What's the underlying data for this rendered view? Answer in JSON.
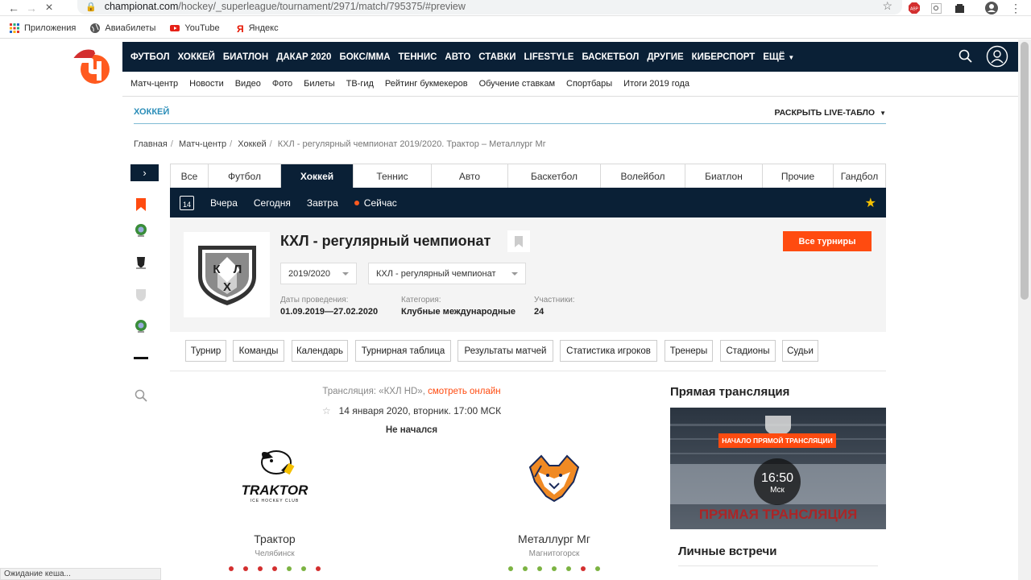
{
  "browser": {
    "url_host": "championat.com",
    "url_path": "/hockey/_superleague/tournament/2971/match/795375/#preview",
    "status_text": "Ожидание кеша..."
  },
  "bookmarks": [
    {
      "label": "Приложения",
      "icon": "apps-grid-icon"
    },
    {
      "label": "Авиабилеты",
      "icon": "globe-icon"
    },
    {
      "label": "YouTube",
      "icon": "youtube-icon"
    },
    {
      "label": "Яндекс",
      "icon": "yandex-icon"
    }
  ],
  "header": {
    "nav": [
      "ФУТБОЛ",
      "ХОККЕЙ",
      "БИАТЛОН",
      "ДАКАР 2020",
      "БОКС/ММА",
      "ТЕННИС",
      "АВТО",
      "СТАВКИ",
      "LIFESTYLE",
      "БАСКЕТБОЛ",
      "ДРУГИЕ",
      "КИБЕРСПОРТ",
      "ЕЩЁ"
    ],
    "subnav": [
      "Матч-центр",
      "Новости",
      "Видео",
      "Фото",
      "Билеты",
      "ТВ-гид",
      "Рейтинг букмекеров",
      "Обучение ставкам",
      "Спортбары",
      "Итоги 2019 года"
    ]
  },
  "section": {
    "title": "ХОККЕЙ",
    "live_link": "РАСКРЫТЬ LIVE-ТАБЛО"
  },
  "breadcrumbs": [
    "Главная",
    "Матч-центр",
    "Хоккей",
    "КХЛ - регулярный чемпионат 2019/2020. Трактор – Металлург Мг"
  ],
  "sport_tabs": [
    {
      "label": "Все",
      "active": false
    },
    {
      "label": "Футбол",
      "active": false
    },
    {
      "label": "Хоккей",
      "active": true
    },
    {
      "label": "Теннис",
      "active": false
    },
    {
      "label": "Авто",
      "active": false
    },
    {
      "label": "Баскетбол",
      "active": false
    },
    {
      "label": "Волейбол",
      "active": false
    },
    {
      "label": "Биатлон",
      "active": false
    },
    {
      "label": "Прочие",
      "active": false
    },
    {
      "label": "Гандбол",
      "active": false
    }
  ],
  "daybar": {
    "calendar_day": "14",
    "days": [
      "Вчера",
      "Сегодня",
      "Завтра"
    ],
    "now": "Сейчас"
  },
  "tournament": {
    "title": "КХЛ - регулярный чемпионат",
    "all_button": "Все турниры",
    "season": "2019/2020",
    "stage": "КХЛ - регулярный чемпионат",
    "dates_label": "Даты проведения:",
    "dates": "01.09.2019—27.02.2020",
    "category_label": "Категория:",
    "category": "Клубные международные",
    "participants_label": "Участники:",
    "participants": "24",
    "logo_letters": [
      "К",
      "Х",
      "Л"
    ]
  },
  "tournament_links": [
    "Турнир",
    "Команды",
    "Календарь",
    "Турнирная таблица",
    "Результаты матчей",
    "Статистика игроков",
    "Тренеры",
    "Стадионы",
    "Судьи"
  ],
  "match": {
    "broadcast_prefix": "Трансляция: «КХЛ HD»,",
    "broadcast_link": "смотреть онлайн",
    "datetime": "14 января 2020, вторник. 17:00 МСК",
    "status": "Не начался",
    "home": {
      "name": "Трактор",
      "city": "Челябинск",
      "logo_text": "TRAKTOR",
      "logo_sub": "ICE HOCKEY CLUB"
    },
    "away": {
      "name": "Металлург Мг",
      "city": "Магнитогорск"
    }
  },
  "aside": {
    "title": "Прямая трансляция",
    "stream_badge": "НАЧАЛО ПРЯМОЙ ТРАНСЛЯЦИИ",
    "stream_time": "16:50",
    "stream_tz": "Мск",
    "stream_caption": "ПРЯМАЯ ТРАНСЛЯЦИЯ",
    "h2h_title": "Личные встречи"
  },
  "colors": {
    "navy": "#0a2036",
    "accent": "#ff4b10",
    "win": "#7cb342",
    "loss": "#d32f2f"
  }
}
